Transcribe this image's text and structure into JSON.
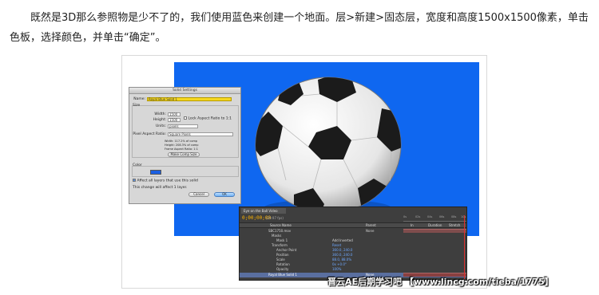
{
  "article": {
    "paragraph": "既然是3D那么参照物是少不了的，我们使用蓝色来创建一个地面。层>新建>固态层，宽度和高度1500x1500像素，单击色板，选择颜色，并单击“确定”。"
  },
  "colors": {
    "canvas_blue": "#0f67f0",
    "swatch_blue": "#1a5fe3",
    "name_field_yellow": "#f6d820",
    "timecode_orange": "#ffb400"
  },
  "solid_settings": {
    "title": "Solid Settings",
    "name_label": "Name:",
    "name_value": "Royal Blue Solid 1",
    "size_label": "Size",
    "width_label": "Width:",
    "width_value": "1500",
    "height_label": "Height:",
    "height_value": "1500",
    "lock_aspect_label": "Lock Aspect Ratio to 1:1",
    "units_label": "Units:",
    "units_value": "pixels",
    "par_label": "Pixel Aspect Ratio:",
    "par_value": "Square Pixels",
    "info_width": "Width: 117.2% of comp",
    "info_height": "Height: 208.3% of comp",
    "info_frame": "Frame Aspect Ratio: 1:1",
    "make_comp_size": "Make Comp Size",
    "color_label": "Color",
    "affect_all_label": "Affect all layers that use this solid",
    "change_note": "This change will affect 1 layer.",
    "cancel": "Cancel",
    "ok": "OK"
  },
  "timeline": {
    "tab_label": "Eye on the Ball Video",
    "timecode": "0;00;00;00",
    "fps": "(29.97 fps)",
    "col_source": "Source Name",
    "col_parent": "Parent",
    "col_in": "In",
    "col_duration": "Duration",
    "col_stretch": "Stretch",
    "rows": [
      {
        "label": "SBC1750.mov",
        "value": ""
      },
      {
        "label": "Masks",
        "value": ""
      },
      {
        "label": "Mask 1",
        "value": "Add   Inverted"
      },
      {
        "label": "Transform",
        "value": "Reset"
      },
      {
        "label": "Anchor Point",
        "value": "360.0, 240.0"
      },
      {
        "label": "Position",
        "value": "360.0, 240.0"
      },
      {
        "label": "Scale",
        "value": "88.0, 88.0%"
      },
      {
        "label": "Rotation",
        "value": "0x +0.0°"
      },
      {
        "label": "Opacity",
        "value": "100%"
      },
      {
        "label": "Royal Blue Solid 1",
        "value": ""
      }
    ],
    "parent_value": "None",
    "ruler_ticks": [
      "0s",
      "02s",
      "04s",
      "06s",
      "08s",
      "10s"
    ]
  },
  "watermark": "晋云AE后期学习吧 【www.lincg.com/tieba/1775】"
}
